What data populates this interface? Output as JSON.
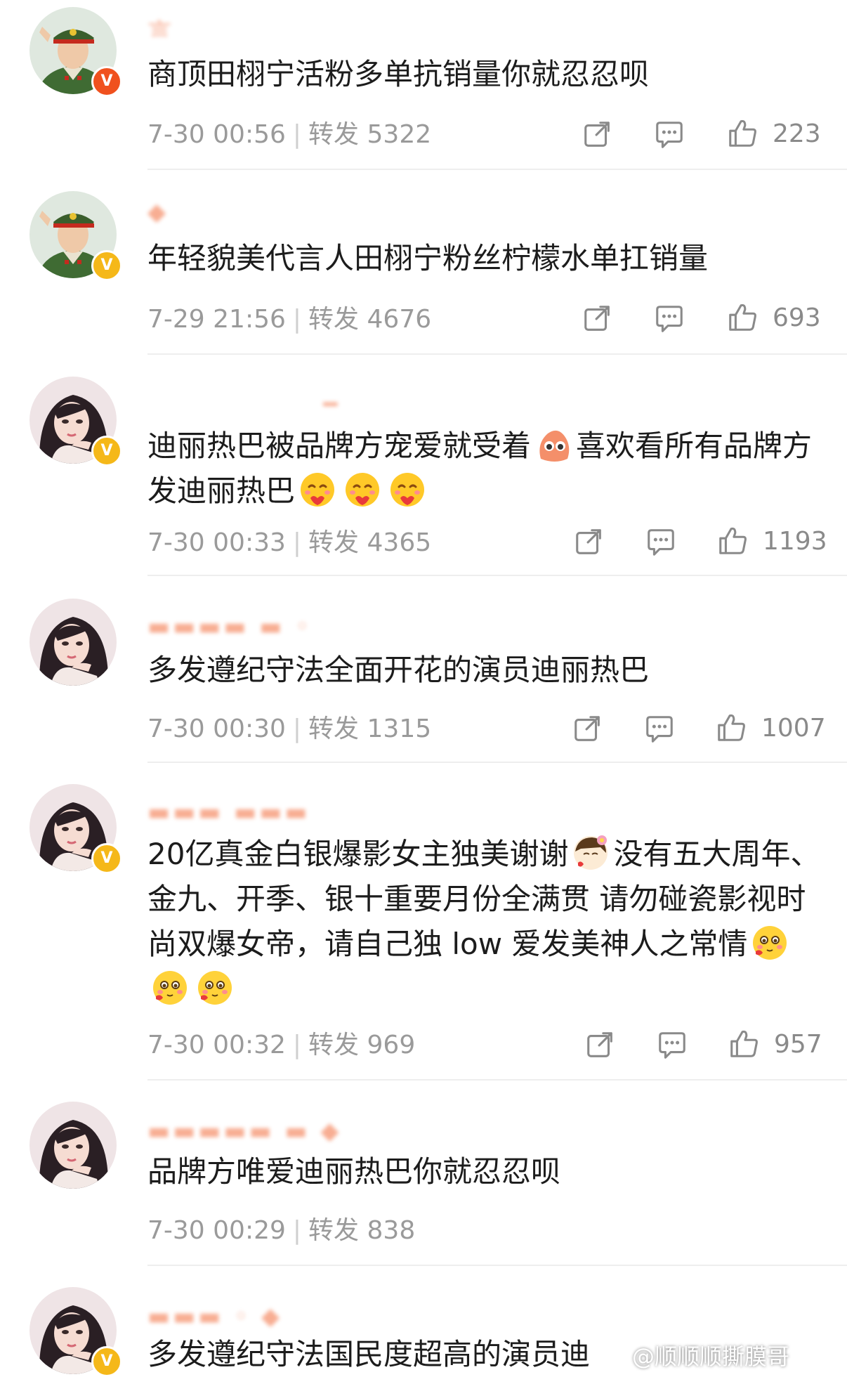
{
  "posts": [
    {
      "content": "商顶田栩宁活粉多单抗销量你就忍忍呗",
      "time": "7-30 00:56",
      "repost_label": "转发",
      "repost_count": "5322",
      "likes": "223",
      "avatar": "soldier-avatar",
      "badge": "red-verified"
    },
    {
      "content": "年轻貌美代言人田栩宁粉丝柠檬水单扛销量",
      "time": "7-29 21:56",
      "repost_label": "转发",
      "repost_count": "4676",
      "likes": "693",
      "avatar": "soldier-avatar",
      "badge": "yellow-verified"
    },
    {
      "content_a": "迪丽热巴被品牌方宠爱就受着",
      "content_b": "喜欢看所有品牌方发迪丽热巴",
      "time": "7-30 00:33",
      "repost_label": "转发",
      "repost_count": "4365",
      "likes": "1193",
      "avatar": "girl-avatar",
      "badge": "yellow-verified"
    },
    {
      "content": "多发遵纪守法全面开花的演员迪丽热巴",
      "time": "7-30 00:30",
      "repost_label": "转发",
      "repost_count": "1315",
      "likes": "1007",
      "avatar": "girl-avatar",
      "badge": "none"
    },
    {
      "content_a": "20亿真金白银爆影女主独美谢谢",
      "content_b": "没有五大周年、金九、开季、银十重要月份全满贯 请勿碰瓷影视时尚双爆女帝，请自己独 low 爱发美神人之常情",
      "time": "7-30 00:32",
      "repost_label": "转发",
      "repost_count": "969",
      "likes": "957",
      "avatar": "girl-avatar",
      "badge": "yellow-verified"
    },
    {
      "content": "品牌方唯爱迪丽热巴你就忍忍呗",
      "time": "7-30 00:29",
      "repost_label": "转发",
      "repost_count": "838",
      "avatar": "girl-avatar",
      "badge": "none"
    },
    {
      "content": "多发遵纪守法国民度超高的演员迪",
      "avatar": "girl-avatar",
      "badge": "yellow-verified"
    }
  ],
  "watermark": "@顺顺顺撕膜哥",
  "colors": {
    "username": "#f26b3a",
    "meta": "#9a9a9a",
    "badge_yellow": "#f5b819",
    "badge_red": "#f0511e"
  }
}
